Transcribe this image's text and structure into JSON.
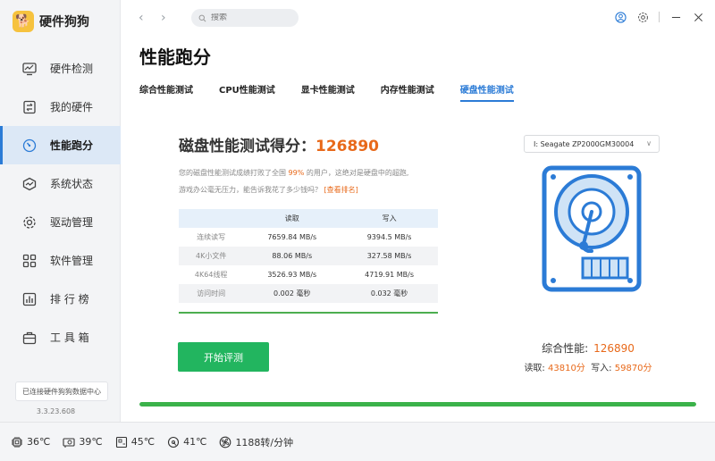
{
  "app": {
    "name": "硬件狗狗",
    "version": "3.3.23.608",
    "sync_status": "已连接硬件狗狗数据中心"
  },
  "sidebar": {
    "items": [
      {
        "label": "硬件检测",
        "icon": "monitor-chart-icon"
      },
      {
        "label": "我的硬件",
        "icon": "hardware-icon"
      },
      {
        "label": "性能跑分",
        "icon": "speedometer-icon",
        "active": true
      },
      {
        "label": "系统状态",
        "icon": "system-status-icon"
      },
      {
        "label": "驱动管理",
        "icon": "gear-icon"
      },
      {
        "label": "软件管理",
        "icon": "apps-icon"
      },
      {
        "label": "排 行 榜",
        "icon": "ranking-icon"
      },
      {
        "label": "工 具 箱",
        "icon": "toolbox-icon"
      }
    ]
  },
  "topbar": {
    "search_placeholder": "搜索"
  },
  "page": {
    "title": "性能跑分",
    "tabs": [
      "综合性能测试",
      "CPU性能测试",
      "显卡性能测试",
      "内存性能测试",
      "硬盘性能测试"
    ],
    "active_tab": 4
  },
  "result": {
    "title_prefix": "磁盘性能测试得分：",
    "score": "126890",
    "desc_part1": "您的磁盘性能测试成绩打败了全国 ",
    "desc_pct": "99%",
    "desc_part2": " 的用户，这绝对是硬盘中的超跑,",
    "desc_line2": "游戏办公毫无压力，能告诉我花了多少钱吗？",
    "rank_link": "[查看排名]"
  },
  "bench_table": {
    "headers": [
      "",
      "读取",
      "写入"
    ],
    "rows": [
      {
        "label": "连续读写",
        "read": "7659.84 MB/s",
        "write": "9394.5 MB/s"
      },
      {
        "label": "4K小文件",
        "read": "88.06 MB/s",
        "write": "327.58 MB/s"
      },
      {
        "label": "4K64线程",
        "read": "3526.93 MB/s",
        "write": "4719.91 MB/s"
      },
      {
        "label": "访问时间",
        "read": "0.002 毫秒",
        "write": "0.032 毫秒"
      }
    ]
  },
  "start_button": "开始评测",
  "drive": {
    "selected": "I: Seagate ZP2000GM30004"
  },
  "summary": {
    "overall_label": "综合性能:",
    "overall_value": "126890",
    "read_label": "读取:",
    "read_value": "43810分",
    "write_label": "写入:",
    "write_value": "59870分"
  },
  "progress": {
    "fraction": 1.0
  },
  "status": [
    {
      "icon": "cpu-temp-icon",
      "value": "36℃"
    },
    {
      "icon": "gpu-temp-icon",
      "value": "39℃"
    },
    {
      "icon": "board-temp-icon",
      "value": "45℃"
    },
    {
      "icon": "disk-temp-icon",
      "value": "41℃"
    },
    {
      "icon": "fan-icon",
      "value": "1188转/分钟"
    }
  ],
  "colors": {
    "accent": "#2b7bd6",
    "score": "#e8691a",
    "button": "#22b55f",
    "progress": "#3bb24a"
  }
}
